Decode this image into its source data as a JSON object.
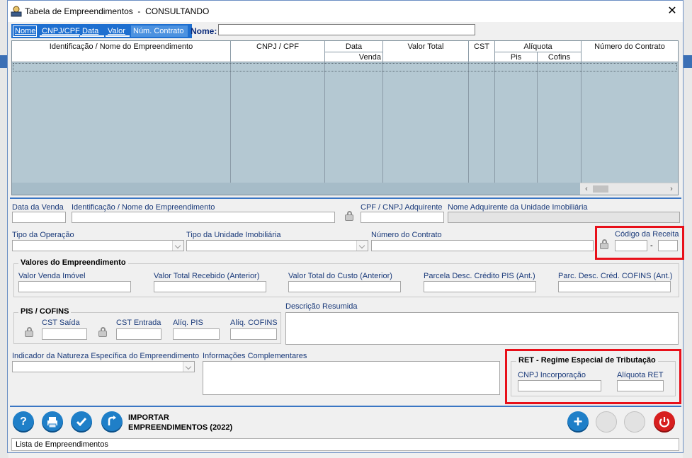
{
  "window": {
    "title": "Tabela de Empreendimentos  -  CONSULTANDO",
    "close_glyph": "✕"
  },
  "search": {
    "tabs": [
      "Nome",
      "CNPJ/CPF",
      "Data",
      "Valor",
      "Núm. Contrato"
    ],
    "label": "Nome:",
    "value": ""
  },
  "grid": {
    "headers": {
      "identificacao": "Identificação / Nome do Empreendimento",
      "cnpj": "CNPJ / CPF",
      "data": "Data",
      "venda": "Venda",
      "valor_total": "Valor Total",
      "cst": "CST",
      "aliquota": "Alíquota",
      "pis": "Pis",
      "cofins": "Cofins",
      "numero_contrato": "Número do Contrato"
    },
    "rows": []
  },
  "form": {
    "data_venda": {
      "label": "Data da Venda",
      "value": ""
    },
    "identificacao": {
      "label": "Identificação / Nome do Empreendimento",
      "value": ""
    },
    "cpf_cnpj": {
      "label": "CPF / CNPJ Adquirente",
      "value": ""
    },
    "nome_adquirente": {
      "label": "Nome Adquirente da Unidade Imobiliária",
      "value": ""
    },
    "tipo_operacao": {
      "label": "Tipo da Operação",
      "value": ""
    },
    "tipo_unidade": {
      "label": "Tipo da Unidade Imobiliária",
      "value": ""
    },
    "numero_contrato": {
      "label": "Número do Contrato",
      "value": ""
    },
    "codigo_receita": {
      "label": "Código da Receita",
      "value": "",
      "suffix": "",
      "sep": "-"
    },
    "valores": {
      "title": "Valores do Empreendimento",
      "venda": {
        "label": "Valor Venda Imóvel",
        "value": ""
      },
      "recebido": {
        "label": "Valor Total Recebido (Anterior)",
        "value": ""
      },
      "custo": {
        "label": "Valor Total do Custo (Anterior)",
        "value": ""
      },
      "parcela_pis": {
        "label": "Parcela Desc. Crédito PIS (Ant.)",
        "value": ""
      },
      "parcela_cofins": {
        "label": "Parc. Desc. Créd. COFINS (Ant.)",
        "value": ""
      }
    },
    "pis_cofins": {
      "title": "PIS / COFINS",
      "cst_saida": {
        "label": "CST Saída",
        "value": ""
      },
      "cst_entrada": {
        "label": "CST Entrada",
        "value": ""
      },
      "aliq_pis": {
        "label": "Alíq. PIS",
        "value": ""
      },
      "aliq_cofins": {
        "label": "Alíq. COFINS",
        "value": ""
      }
    },
    "descricao": {
      "label": "Descrição Resumida",
      "value": ""
    },
    "indicador": {
      "label": "Indicador da Natureza Específica do Empreendimento",
      "value": ""
    },
    "info_complementares": {
      "label": "Informações Complementares",
      "value": ""
    },
    "ret": {
      "title": "RET - Regime Especial de Tributação",
      "cnpj": {
        "label": "CNPJ Incorporação",
        "value": ""
      },
      "aliquota": {
        "label": "Alíquota RET",
        "value": ""
      }
    }
  },
  "toolbar": {
    "import_line1": "IMPORTAR",
    "import_line2": "EMPREENDIMENTOS (2022)"
  },
  "status": {
    "text": "Lista de Empreendimentos"
  },
  "colors": {
    "accent_blue": "#1e6fd0",
    "grid_bg": "#b4c8d2",
    "highlight_red": "#e8101a",
    "close_red": "#d71f1f"
  }
}
